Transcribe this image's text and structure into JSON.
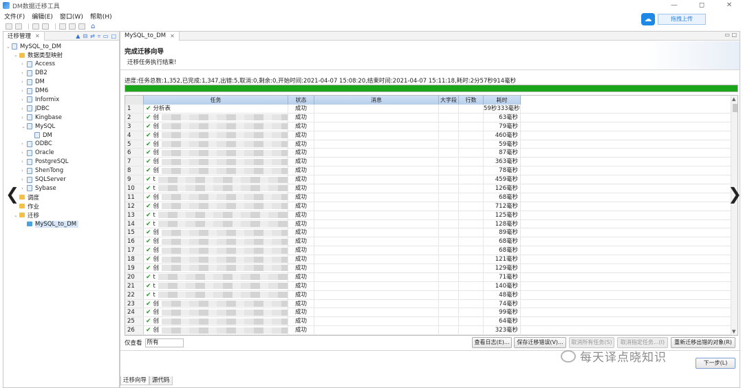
{
  "window": {
    "title": "DM数据迁移工具",
    "btn_min": "—",
    "btn_max": "◻",
    "btn_close": "✕"
  },
  "menu": [
    "文件(F)",
    "编辑(E)",
    "窗口(W)",
    "帮助(H)"
  ],
  "upload": {
    "label": "拖拽上传",
    "cloud_icon": "☁"
  },
  "left_panel": {
    "tab_label": "迁移管理",
    "tree": [
      {
        "label": "MySQL_to_DM",
        "level": 0,
        "icon": "project-icon",
        "arrow": "⌄"
      },
      {
        "label": "数据类型映射",
        "level": 1,
        "icon": "folder-icon",
        "arrow": "⌄"
      },
      {
        "label": "Access",
        "level": 2,
        "icon": "db-icon",
        "arrow": "›"
      },
      {
        "label": "DB2",
        "level": 2,
        "icon": "db-icon",
        "arrow": "›"
      },
      {
        "label": "DM",
        "level": 2,
        "icon": "db-icon",
        "arrow": "›"
      },
      {
        "label": "DM6",
        "level": 2,
        "icon": "db-icon",
        "arrow": "›"
      },
      {
        "label": "Informix",
        "level": 2,
        "icon": "db-icon",
        "arrow": "›"
      },
      {
        "label": "JDBC",
        "level": 2,
        "icon": "db-icon",
        "arrow": "›"
      },
      {
        "label": "Kingbase",
        "level": 2,
        "icon": "db-icon",
        "arrow": "›"
      },
      {
        "label": "MySQL",
        "level": 2,
        "icon": "db-icon",
        "arrow": "⌄"
      },
      {
        "label": "DM",
        "level": 3,
        "icon": "db-icon",
        "arrow": ""
      },
      {
        "label": "ODBC",
        "level": 2,
        "icon": "db-icon",
        "arrow": "›"
      },
      {
        "label": "Oracle",
        "level": 2,
        "icon": "db-icon",
        "arrow": "›"
      },
      {
        "label": "PostgreSQL",
        "level": 2,
        "icon": "db-icon",
        "arrow": "›"
      },
      {
        "label": "ShenTong",
        "level": 2,
        "icon": "db-icon",
        "arrow": "›"
      },
      {
        "label": "SQLServer",
        "level": 2,
        "icon": "db-icon",
        "arrow": "›"
      },
      {
        "label": "Sybase",
        "level": 2,
        "icon": "db-icon",
        "arrow": "›"
      },
      {
        "label": "调度",
        "level": 1,
        "icon": "folder-icon",
        "arrow": ""
      },
      {
        "label": "作业",
        "level": 1,
        "icon": "folder-icon",
        "arrow": ""
      },
      {
        "label": "迁移",
        "level": 1,
        "icon": "folder-icon",
        "arrow": "⌄"
      },
      {
        "label": "MySQL_to_DM",
        "level": 2,
        "icon": "migration-icon",
        "arrow": "",
        "selected": true
      }
    ]
  },
  "editor": {
    "tab_label": "MySQL_to_DM",
    "wizard_title": "完成迁移向导",
    "wizard_subtitle": "迁移任务执行结束!",
    "progress_text": "进度:任务总数:1,352,已完成:1,347,出错:5,取消:0,剩余:0,开始时间:2021-04-07 15:08:20,结束时间:2021-04-07 15:11:18,耗时:2分57秒914毫秒",
    "progress_fraction": 1.0,
    "table": {
      "headers": [
        "任务",
        "状态",
        "消息",
        "大字段",
        "行数",
        "耗时"
      ],
      "rows": [
        {
          "n": "1",
          "task": "分析表",
          "status": "成功",
          "time": "59秒333毫秒"
        },
        {
          "n": "2",
          "task": "创",
          "status": "成功",
          "time": "63毫秒"
        },
        {
          "n": "3",
          "task": "创",
          "status": "成功",
          "time": "79毫秒"
        },
        {
          "n": "4",
          "task": "创",
          "status": "成功",
          "time": "460毫秒"
        },
        {
          "n": "5",
          "task": "创",
          "status": "成功",
          "time": "59毫秒"
        },
        {
          "n": "6",
          "task": "创",
          "status": "成功",
          "time": "87毫秒"
        },
        {
          "n": "7",
          "task": "创",
          "status": "成功",
          "time": "363毫秒"
        },
        {
          "n": "8",
          "task": "创",
          "status": "成功",
          "time": "78毫秒"
        },
        {
          "n": "9",
          "task": "t",
          "status": "成功",
          "time": "459毫秒"
        },
        {
          "n": "10",
          "task": "t",
          "status": "成功",
          "time": "126毫秒"
        },
        {
          "n": "11",
          "task": "创",
          "status": "成功",
          "time": "68毫秒"
        },
        {
          "n": "12",
          "task": "创",
          "status": "成功",
          "time": "712毫秒"
        },
        {
          "n": "13",
          "task": "t",
          "status": "成功",
          "time": "125毫秒"
        },
        {
          "n": "14",
          "task": "t",
          "status": "成功",
          "time": "128毫秒"
        },
        {
          "n": "15",
          "task": "创",
          "status": "成功",
          "time": "89毫秒"
        },
        {
          "n": "16",
          "task": "创",
          "status": "成功",
          "time": "68毫秒"
        },
        {
          "n": "17",
          "task": "创",
          "status": "成功",
          "time": "68毫秒"
        },
        {
          "n": "18",
          "task": "创",
          "status": "成功",
          "time": "121毫秒"
        },
        {
          "n": "19",
          "task": "创",
          "status": "成功",
          "time": "129毫秒"
        },
        {
          "n": "20",
          "task": "t",
          "status": "成功",
          "time": "71毫秒"
        },
        {
          "n": "21",
          "task": "t",
          "status": "成功",
          "time": "140毫秒"
        },
        {
          "n": "22",
          "task": "t",
          "status": "成功",
          "time": "48毫秒"
        },
        {
          "n": "23",
          "task": "创",
          "status": "成功",
          "time": "74毫秒"
        },
        {
          "n": "24",
          "task": "创",
          "status": "成功",
          "time": "99毫秒"
        },
        {
          "n": "25",
          "task": "创",
          "status": "成功",
          "time": "64毫秒"
        },
        {
          "n": "26",
          "task": "创",
          "status": "成功",
          "time": "323毫秒"
        }
      ]
    },
    "filter": {
      "label": "仅查看",
      "value": "所有"
    },
    "buttons": {
      "view_log": "查看日志(E)...",
      "save_errors": "保存迁移错误(V)...",
      "cancel_all": "取消所有任务(S)",
      "cancel_selected": "取消指定任务...(I)",
      "retry_errors": "重新迁移出错的对象(R)",
      "next": "下一步(L)"
    },
    "bottom_tabs": [
      "迁移向导",
      "源代码"
    ]
  },
  "watermark": "每天译点晓知识",
  "colors": {
    "progress": "#1aa51a",
    "header": "#cfe0f4",
    "check": "#21a021"
  }
}
